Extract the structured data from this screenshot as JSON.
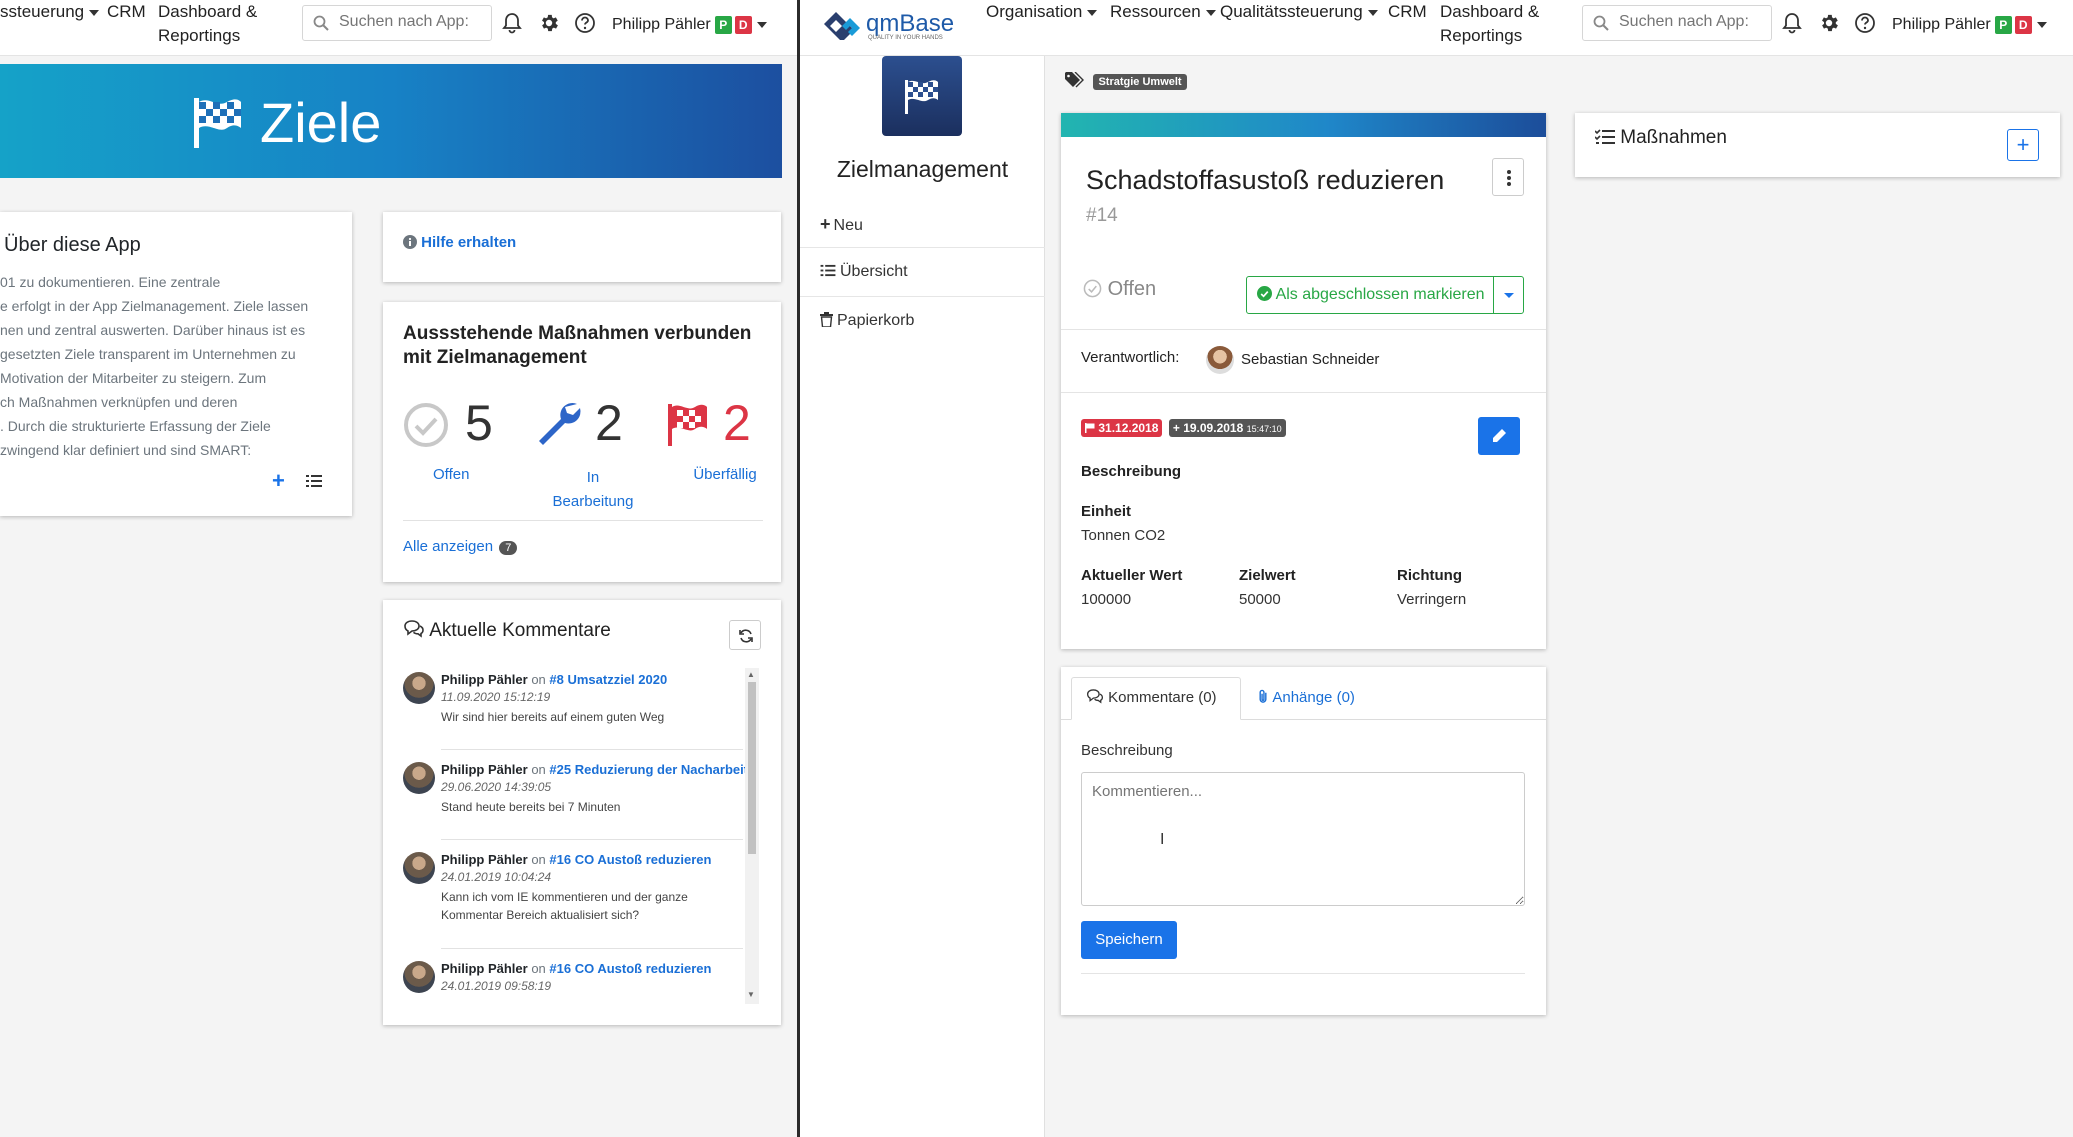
{
  "left": {
    "nav": {
      "items": [
        "ssteuerung",
        "CRM",
        "Dashboard &",
        "Reportings"
      ],
      "search_placeholder": "Suchen nach App:",
      "user": "Philipp Pähler",
      "badge_p": "P",
      "badge_d": "D"
    },
    "banner": {
      "title": "Ziele"
    },
    "about": {
      "title": "Über diese App",
      "lines": [
        "01 zu dokumentieren. Eine zentrale",
        "e erfolgt in der App Zielmanagement. Ziele lassen",
        "nen und zentral auswerten. Darüber hinaus ist es",
        "gesetzten Ziele transparent im Unternehmen zu",
        "Motivation der Mitarbeiter zu steigern. Zum",
        "ch Maßnahmen verknüpfen und deren",
        ". Durch die strukturierte Erfassung der Ziele",
        "zwingend klar definiert und sind SMART:"
      ]
    },
    "help": {
      "label": "Hilfe erhalten"
    },
    "pending": {
      "title_line1": "Aussstehende Maßnahmen verbunden",
      "title_line2": "mit Zielmanagement",
      "stats": [
        {
          "count": "5",
          "label": "Offen",
          "label2": ""
        },
        {
          "count": "2",
          "label": "In",
          "label2": "Bearbeitung"
        },
        {
          "count": "2",
          "label": "Überfällig",
          "label2": ""
        }
      ],
      "show_all": "Alle anzeigen",
      "show_all_count": "7"
    },
    "comments": {
      "title": "Aktuelle Kommentare",
      "on_word": "on",
      "items": [
        {
          "author": "Philipp Pähler",
          "target": "#8 Umsatzziel 2020",
          "date": "11.09.2020 15:12:19",
          "text": "Wir sind hier bereits auf einem guten Weg"
        },
        {
          "author": "Philipp Pähler",
          "target": "#25 Reduzierung der Nacharbeit",
          "date": "29.06.2020 14:39:05",
          "text": "Stand heute bereits bei 7 Minuten"
        },
        {
          "author": "Philipp Pähler",
          "target": "#16 CO Austoß reduzieren",
          "date": "24.01.2019 10:04:24",
          "text": "Kann ich vom IE kommentieren und der ganze Kommentar Bereich aktualisiert sich?"
        },
        {
          "author": "Philipp Pähler",
          "target": "#16 CO Austoß reduzieren",
          "date": "24.01.2019 09:58:19",
          "text": ""
        }
      ]
    }
  },
  "right": {
    "nav": {
      "logo": "qmBase",
      "logo_tagline": "QUALITY IN YOUR HANDS",
      "items": [
        "Organisation",
        "Ressourcen",
        "Qualitätssteuerung",
        "CRM",
        "Dashboard &",
        "Reportings"
      ],
      "search_placeholder": "Suchen nach App:",
      "user": "Philipp Pähler",
      "badge_p": "P",
      "badge_d": "D"
    },
    "sidebar": {
      "app_title": "Zielmanagement",
      "items": [
        "Neu",
        "Übersicht",
        "Papierkorb"
      ]
    },
    "tag": "Stratgie Umwelt",
    "goal": {
      "title": "Schadstoffasustoß reduzieren",
      "number": "#14",
      "status": "Offen",
      "complete_button": "Als abgeschlossen markieren",
      "responsible_label": "Verantwortlich:",
      "responsible_name": "Sebastian Schneider",
      "due_date": "31.12.2018",
      "created_date": "19.09.2018",
      "created_time": "15:47:10",
      "description_label": "Beschreibung",
      "unit_label": "Einheit",
      "unit_value": "Tonnen CO2",
      "current_label": "Aktueller Wert",
      "current_value": "100000",
      "target_label": "Zielwert",
      "target_value": "50000",
      "direction_label": "Richtung",
      "direction_value": "Verringern"
    },
    "comment_panel": {
      "tab_comments": "Kommentare (0)",
      "tab_attachments": "Anhänge (0)",
      "field_label": "Beschreibung",
      "placeholder": "Kommentieren...",
      "save_button": "Speichern"
    },
    "measures": {
      "title": "Maßnahmen"
    }
  },
  "colors": {
    "primary": "#1a73e8",
    "success": "#28a745",
    "danger": "#dc3545",
    "accent": "#26b6b6"
  }
}
